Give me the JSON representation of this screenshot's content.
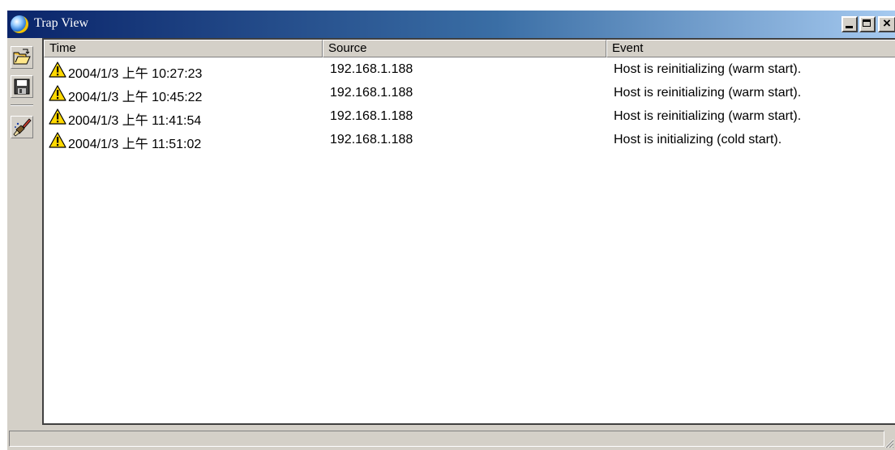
{
  "window": {
    "title": "Trap View",
    "buttons": {
      "minimize": "minimize",
      "maximize": "maximize",
      "close": "×"
    }
  },
  "toolbar": {
    "buttons": [
      {
        "name": "open",
        "icon": "open-folder-icon"
      },
      {
        "name": "save",
        "icon": "floppy-disk-icon"
      },
      {
        "name": "clear",
        "icon": "clear-brush-icon"
      }
    ]
  },
  "table": {
    "columns": [
      "Time",
      "Source",
      "Event"
    ],
    "rows": [
      {
        "icon": "warning-icon",
        "time": "2004/1/3 上午 10:27:23",
        "source": "192.168.1.188",
        "event": "Host is reinitializing (warm start)."
      },
      {
        "icon": "warning-icon",
        "time": "2004/1/3 上午 10:45:22",
        "source": "192.168.1.188",
        "event": "Host is reinitializing (warm start)."
      },
      {
        "icon": "warning-icon",
        "time": "2004/1/3 上午 11:41:54",
        "source": "192.168.1.188",
        "event": "Host is reinitializing (warm start)."
      },
      {
        "icon": "warning-icon",
        "time": "2004/1/3 上午 11:51:02",
        "source": "192.168.1.188",
        "event": "Host is initializing (cold start)."
      }
    ]
  },
  "statusbar": {
    "text": ""
  },
  "colors": {
    "titlebar_start": "#0a246a",
    "titlebar_end": "#a6caf0",
    "face": "#d4d0c8",
    "warning": "#ffd800"
  }
}
